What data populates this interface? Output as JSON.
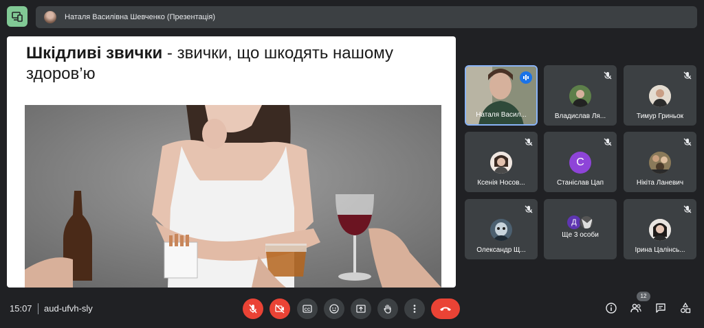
{
  "presenter": {
    "label": "Наталя Василівна Шевченко (Презентація)"
  },
  "slide": {
    "title_bold": "Шкідливі звички",
    "title_rest": " - звички, що шкодять нашому здоров’ю"
  },
  "participants": [
    {
      "name": "Наталя Васил...",
      "state": "speaking",
      "avatar": "video"
    },
    {
      "name": "Владислав Ля...",
      "state": "muted",
      "avatar": "photo"
    },
    {
      "name": "Тимур Гриньок",
      "state": "muted",
      "avatar": "photo"
    },
    {
      "name": "Ксенія Носов...",
      "state": "muted",
      "avatar": "photo"
    },
    {
      "name": "Станіслав Цап",
      "state": "muted",
      "avatar": "letter",
      "initial": "С",
      "color": "#8e44d8"
    },
    {
      "name": "Нікіта Ланевич",
      "state": "muted",
      "avatar": "photo"
    },
    {
      "name": "Олександр Щ...",
      "state": "muted",
      "avatar": "photo"
    },
    {
      "name": "Ще 3 особи",
      "state": "group",
      "initial": "Д",
      "color": "#5e35b1"
    },
    {
      "name": "Ірина Цалінсь...",
      "state": "muted",
      "avatar": "photo"
    }
  ],
  "meeting": {
    "time": "15:07",
    "separator": "|",
    "code": "aud-ufvh-sly"
  },
  "controls": [
    "mic-off",
    "camera-off",
    "captions",
    "emoji",
    "present",
    "raise-hand",
    "more",
    "end-call"
  ],
  "people_count": "12",
  "colors": {
    "background": "#202124",
    "tile": "#3c4043",
    "danger": "#ea4335",
    "accent": "#1a73e8",
    "app_icon": "#81c995"
  }
}
